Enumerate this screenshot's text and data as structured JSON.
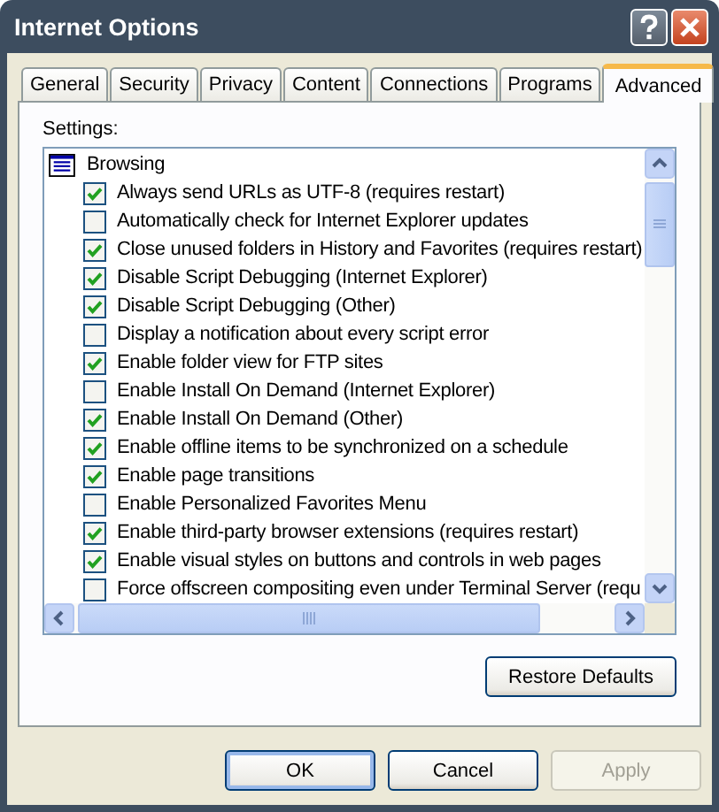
{
  "window": {
    "title": "Internet Options"
  },
  "tabs": [
    {
      "label": "General",
      "selected": false
    },
    {
      "label": "Security",
      "selected": false
    },
    {
      "label": "Privacy",
      "selected": false
    },
    {
      "label": "Content",
      "selected": false
    },
    {
      "label": "Connections",
      "selected": false
    },
    {
      "label": "Programs",
      "selected": false
    },
    {
      "label": "Advanced",
      "selected": true
    }
  ],
  "settings_label": "Settings:",
  "settings": {
    "group": "Browsing",
    "items": [
      {
        "label": "Always send URLs as UTF-8 (requires restart)",
        "checked": true
      },
      {
        "label": "Automatically check for Internet Explorer updates",
        "checked": false
      },
      {
        "label": "Close unused folders in History and Favorites (requires restart)",
        "checked": true
      },
      {
        "label": "Disable Script Debugging (Internet Explorer)",
        "checked": true
      },
      {
        "label": "Disable Script Debugging (Other)",
        "checked": true
      },
      {
        "label": "Display a notification about every script error",
        "checked": false
      },
      {
        "label": "Enable folder view for FTP sites",
        "checked": true
      },
      {
        "label": "Enable Install On Demand (Internet Explorer)",
        "checked": false
      },
      {
        "label": "Enable Install On Demand (Other)",
        "checked": true
      },
      {
        "label": "Enable offline items to be synchronized on a schedule",
        "checked": true
      },
      {
        "label": "Enable page transitions",
        "checked": true
      },
      {
        "label": "Enable Personalized Favorites Menu",
        "checked": false
      },
      {
        "label": "Enable third-party browser extensions (requires restart)",
        "checked": true
      },
      {
        "label": "Enable visual styles on buttons and controls in web pages",
        "checked": true
      },
      {
        "label": "Force offscreen compositing even under Terminal Server (requ",
        "checked": false
      }
    ]
  },
  "restore_button": "Restore Defaults",
  "buttons": [
    {
      "label": "OK",
      "disabled": false
    },
    {
      "label": "Cancel",
      "disabled": false
    },
    {
      "label": "Apply",
      "disabled": true
    }
  ]
}
